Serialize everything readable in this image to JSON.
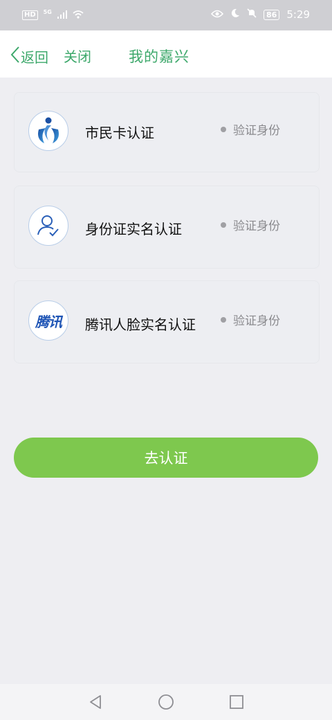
{
  "status_bar": {
    "hd_label": "HD",
    "network_label": "5G",
    "battery_level": "86",
    "time": "5:29",
    "icons": [
      "signal-icon",
      "wifi-icon",
      "eye-icon",
      "moon-icon",
      "mute-icon",
      "battery-icon"
    ]
  },
  "header": {
    "back_label": "返回",
    "close_label": "关闭",
    "title": "我的嘉兴",
    "accent_color": "#3da86b"
  },
  "verification_options": [
    {
      "title": "市民卡认证",
      "status": "验证身份",
      "icon": "citizen-card-logo"
    },
    {
      "title": "身份证实名认证",
      "status": "验证身份",
      "icon": "user-check-icon"
    },
    {
      "title": "腾讯人脸实名认证",
      "status": "验证身份",
      "icon": "tencent-logo",
      "logo_text": "腾讯"
    }
  ],
  "action_button": {
    "label": "去认证",
    "color": "#7ec84e"
  },
  "nav_bar": {
    "buttons": [
      "back-triangle-icon",
      "home-circle-icon",
      "recents-square-icon"
    ]
  }
}
